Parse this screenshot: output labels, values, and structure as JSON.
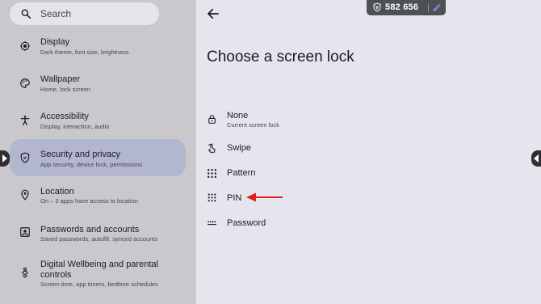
{
  "search": {
    "placeholder": "Search"
  },
  "sidebar": {
    "items": [
      {
        "title": "Display",
        "subtitle": "Dark theme, font size, brightness",
        "icon": "display-settings-icon"
      },
      {
        "title": "Wallpaper",
        "subtitle": "Home, lock screen",
        "icon": "palette-icon"
      },
      {
        "title": "Accessibility",
        "subtitle": "Display, interaction, audio",
        "icon": "accessibility-icon"
      },
      {
        "title": "Security and privacy",
        "subtitle": "App security, device lock, permissions",
        "icon": "shield-icon",
        "selected": true
      },
      {
        "title": "Location",
        "subtitle": "On – 3 apps have access to location",
        "icon": "location-pin-icon"
      },
      {
        "title": "Passwords and accounts",
        "subtitle": "Saved passwords, autofill, synced accounts",
        "icon": "account-box-icon"
      },
      {
        "title": "Digital Wellbeing and parental controls",
        "subtitle": "Screen time, app timers, bedtime schedules",
        "icon": "wellbeing-icon"
      }
    ]
  },
  "main": {
    "title": "Choose a screen lock",
    "options": [
      {
        "label": "None",
        "subtitle": "Current screen lock",
        "icon": "lock-open-icon"
      },
      {
        "label": "Swipe",
        "subtitle": "",
        "icon": "swipe-icon"
      },
      {
        "label": "Pattern",
        "subtitle": "",
        "icon": "pattern-icon"
      },
      {
        "label": "PIN",
        "subtitle": "",
        "icon": "pin-dialpad-icon"
      },
      {
        "label": "Password",
        "subtitle": "",
        "icon": "password-icon"
      }
    ]
  },
  "counter": {
    "value": "582 656"
  },
  "colors": {
    "accent_selected": "#b3b6cf",
    "annotation_arrow": "#e02020",
    "left_pane": "#c9c8cd",
    "right_pane": "#e6e5ee"
  }
}
